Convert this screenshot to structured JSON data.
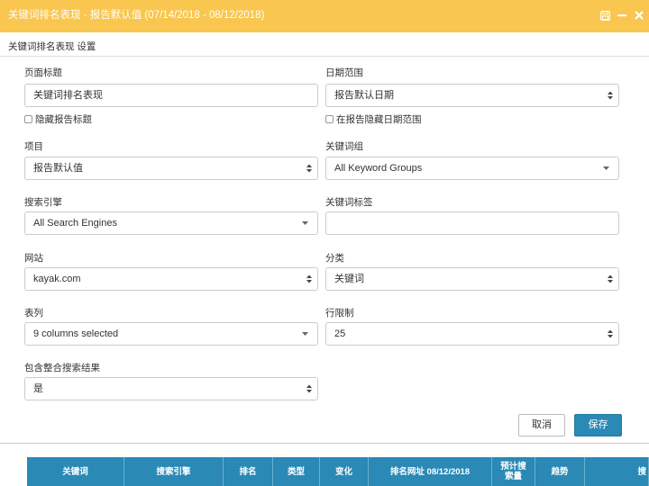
{
  "window": {
    "title": "关键词排名表现 - 报告默认值 (07/14/2018 - 08/12/2018)",
    "controls": [
      "save-icon",
      "minimize-icon",
      "close-icon"
    ]
  },
  "settings": {
    "heading": "关键词排名表现 设置",
    "page_title": {
      "label": "页面标题",
      "value": "关键词排名表现"
    },
    "hide_title": {
      "label": "隐藏报告标题"
    },
    "date_range": {
      "label": "日期范围",
      "value": "报告默认日期"
    },
    "hide_date": {
      "label": "在报告隐藏日期范围"
    },
    "project": {
      "label": "项目",
      "value": "报告默认值"
    },
    "keyword_group": {
      "label": "关键词组",
      "value": "All Keyword Groups"
    },
    "search_engine": {
      "label": "搜索引擎",
      "value": "All Search Engines"
    },
    "keyword_tag": {
      "label": "关键词标签",
      "value": ""
    },
    "site": {
      "label": "网站",
      "value": "kayak.com"
    },
    "category": {
      "label": "分类",
      "value": "关键词"
    },
    "columns": {
      "label": "表列",
      "value": "9 columns selected"
    },
    "row_limit": {
      "label": "行限制",
      "value": "25"
    },
    "include_universal": {
      "label": "包含整合搜索结果",
      "value": "是"
    }
  },
  "buttons": {
    "cancel": "取消",
    "save": "保存"
  },
  "table": {
    "headers": [
      "关键词",
      "搜索引擎",
      "排名",
      "类型",
      "变化",
      "排名网址 08/12/2018",
      "预计搜索量",
      "趋势",
      "搜"
    ]
  },
  "colors": {
    "titlebar": "#f9c64f",
    "accent": "#2a89b5"
  }
}
